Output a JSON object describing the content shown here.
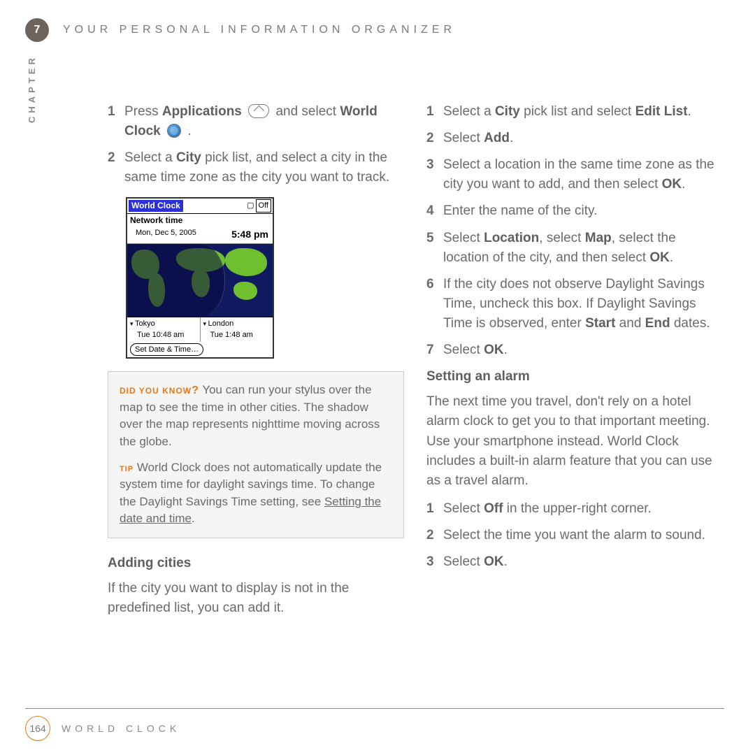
{
  "chapter_number": "7",
  "header_title": "YOUR PERSONAL INFORMATION ORGANIZER",
  "side_label": "CHAPTER",
  "left": {
    "step1_a": "Press ",
    "step1_b": "Applications",
    "step1_c": " and select ",
    "step1_d": "World Clock",
    "step1_e": " .",
    "step2_a": "Select a ",
    "step2_b": "City",
    "step2_c": " pick list, and select a city in the same time zone as the city you want to track."
  },
  "wc": {
    "title": "World Clock",
    "off": "Off",
    "net": "Network time",
    "date": "Mon, Dec 5, 2005",
    "time": "5:48 pm",
    "city1": "Tokyo",
    "city1_line": "Tue   10:48 am",
    "city2": "London",
    "city2_line": "Tue     1:48 am",
    "set": "Set Date & Time…"
  },
  "callout": {
    "dyk_label": "DID YOU KNOW",
    "dyk_q": "?",
    "dyk_text": " You can run your stylus over the map to see the time in other cities. The shadow over the map represents nighttime moving across the globe.",
    "tip_label": "TIP",
    "tip_text_a": " World Clock does not automatically update the system time for daylight savings time. To change the Daylight Savings Time setting, see ",
    "tip_link": "Setting the date and time",
    "tip_text_b": "."
  },
  "adding": {
    "heading": "Adding cities",
    "intro": "If the city you want to display is not in the predefined list, you can add it."
  },
  "right": {
    "s1_a": "Select a ",
    "s1_b": "City",
    "s1_c": " pick list and select ",
    "s1_d": "Edit List",
    "s1_e": ".",
    "s2_a": "Select ",
    "s2_b": "Add",
    "s2_c": ".",
    "s3_a": "Select a location in the same time zone as the city you want to add, and then select ",
    "s3_b": "OK",
    "s3_c": ".",
    "s4": "Enter the name of the city.",
    "s5_a": "Select ",
    "s5_b": "Location",
    "s5_c": ", select ",
    "s5_d": "Map",
    "s5_e": ", select the location of the city, and then select ",
    "s5_f": "OK",
    "s5_g": ".",
    "s6_a": "If the city does not observe Daylight Savings Time, uncheck this box. If Daylight Savings Time is observed, enter ",
    "s6_b": "Start",
    "s6_c": " and ",
    "s6_d": "End",
    "s6_e": " dates.",
    "s7_a": "Select ",
    "s7_b": "OK",
    "s7_c": "."
  },
  "alarm": {
    "heading": "Setting an alarm",
    "intro": "The next time you travel, don't rely on a hotel alarm clock to get you to that important meeting. Use your smartphone instead. World Clock includes a built-in alarm feature that you can use as a travel alarm.",
    "s1_a": "Select ",
    "s1_b": "Off",
    "s1_c": " in the upper-right corner.",
    "s2": "Select the time you want the alarm to sound.",
    "s3_a": "Select ",
    "s3_b": "OK",
    "s3_c": "."
  },
  "footer": {
    "page": "164",
    "label": "WORLD CLOCK"
  }
}
